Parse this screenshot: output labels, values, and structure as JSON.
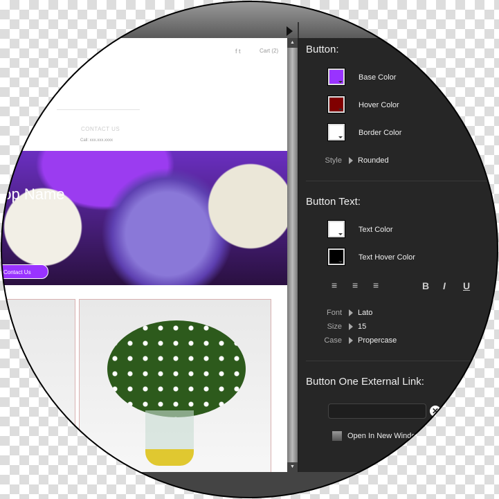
{
  "preview": {
    "cart": "Cart (2)",
    "social": "f t",
    "contact_heading": "CONTACT US",
    "call": "Call: xxx.xxx.xxxx",
    "shop_name": "hop Name",
    "hero_button": "Contact Us"
  },
  "toolbar": {
    "play_icon": "play-triangle"
  },
  "panel": {
    "button_title": "Button:",
    "button_colors": [
      {
        "label": "Base Color",
        "color": "#9933ff"
      },
      {
        "label": "Hover Color",
        "color": "#800000"
      },
      {
        "label": "Border Color",
        "color": "#ffffff"
      }
    ],
    "style_label": "Style",
    "style_value": "Rounded",
    "button_text_title": "Button Text:",
    "text_colors": [
      {
        "label": "Text Color",
        "color": "#ffffff"
      },
      {
        "label": "Text Hover Color",
        "color": "#000000"
      }
    ],
    "format": {
      "align_right": "≡",
      "align_center": "≡",
      "align_left": "≡",
      "bold": "B",
      "italic": "I",
      "underline": "U"
    },
    "font_label": "Font",
    "font_value": "Lato",
    "size_label": "Size",
    "size_value": "15",
    "case_label": "Case",
    "case_value": "Propercase",
    "link_title": "Button One External Link:",
    "link_value": "",
    "clear": "✕",
    "open_new_window": "Open In New Window"
  }
}
